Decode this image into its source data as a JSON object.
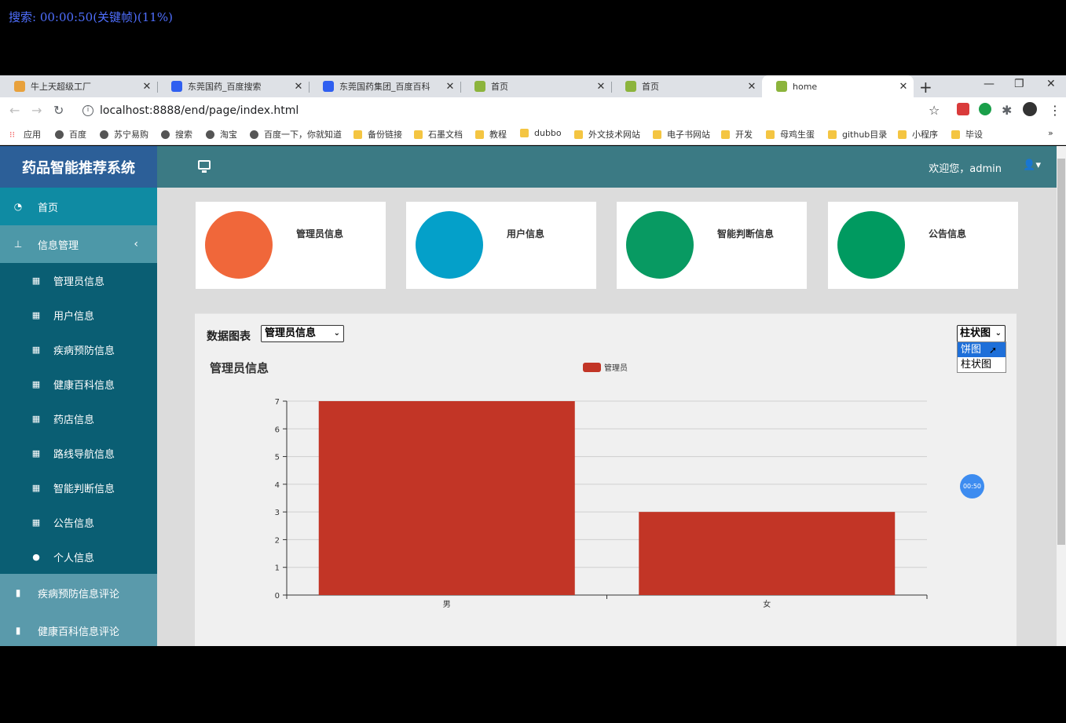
{
  "overlay_status": "搜索: 00:00:50(关键帧)(11%)",
  "browser": {
    "tabs": [
      {
        "title": "牛上天超级工厂",
        "fav_color": "#e8a13c"
      },
      {
        "title": "东莞国药_百度搜索",
        "fav_color": "#2f5ff0"
      },
      {
        "title": "东莞国药集团_百度百科",
        "fav_color": "#2f5ff0"
      },
      {
        "title": "首页",
        "fav_color": "#8cb43c"
      },
      {
        "title": "首页",
        "fav_color": "#8cb43c"
      },
      {
        "title": "home",
        "fav_color": "#8cb43c"
      }
    ],
    "url": "localhost:8888/end/page/index.html",
    "bookmarks": [
      "应用",
      "百度",
      "苏宁易购",
      "搜索",
      "淘宝",
      "百度一下，你就知道",
      "备份链接",
      "石墨文档",
      "教程",
      "dubbo",
      "外文技术网站",
      "电子书网站",
      "开发",
      "母鸡生蛋",
      "github目录",
      "小程序",
      "毕设"
    ]
  },
  "app": {
    "brand": "药品智能推荐系统",
    "welcome": "欢迎您，admin",
    "menu": {
      "home": "首页",
      "info_management": "信息管理",
      "sub_items": [
        "管理员信息",
        "用户信息",
        "疾病预防信息",
        "健康百科信息",
        "药店信息",
        "路线导航信息",
        "智能判断信息",
        "公告信息",
        "个人信息"
      ],
      "disease_comments": "疾病预防信息评论",
      "health_comments": "健康百科信息评论"
    },
    "cards": [
      {
        "label": "管理员信息",
        "color": "#f0673a"
      },
      {
        "label": "用户信息",
        "color": "#04a0c9"
      },
      {
        "label": "智能判断信息",
        "color": "#089a62"
      },
      {
        "label": "公告信息",
        "color": "#009a60"
      }
    ],
    "chart_panel": {
      "title": "数据图表",
      "category_select": "管理员信息",
      "type_select": "柱状图",
      "type_options": [
        "饼图",
        "柱状图"
      ]
    },
    "record_badge": "00:50"
  },
  "chart_data": {
    "type": "bar",
    "title": "管理员信息",
    "categories": [
      "男",
      "女"
    ],
    "series": [
      {
        "name": "管理员",
        "values": [
          7,
          3
        ],
        "color": "#c23526"
      }
    ],
    "ylim": [
      0,
      7
    ],
    "yticks": [
      "0",
      "1",
      "2",
      "3",
      "4",
      "5",
      "6",
      "7"
    ],
    "grid": true,
    "legend": "top-center"
  }
}
